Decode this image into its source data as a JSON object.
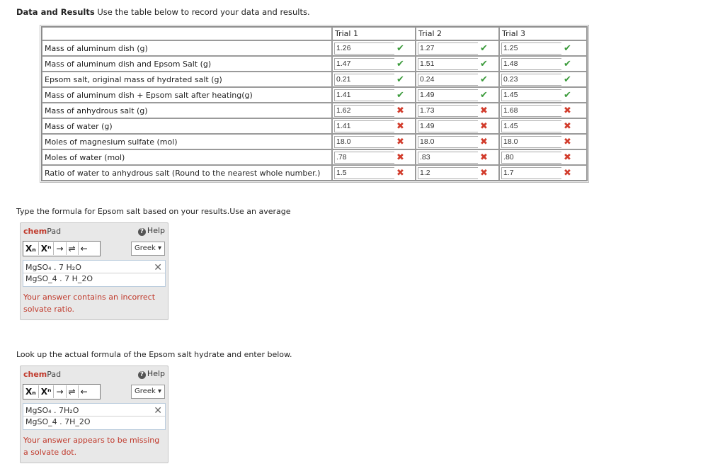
{
  "heading": {
    "bold": "Data and Results",
    "text": " Use the table below to record your data and results."
  },
  "table": {
    "trial_headers": [
      "Trial 1",
      "Trial 2",
      "Trial 3"
    ],
    "rows": [
      {
        "label": "Mass of aluminum dish (g)",
        "values": [
          "1.26",
          "1.27",
          "1.25"
        ],
        "status": [
          "correct",
          "correct",
          "correct"
        ]
      },
      {
        "label": "Mass of aluminum dish and Epsom Salt (g)",
        "values": [
          "1.47",
          "1.51",
          "1.48"
        ],
        "status": [
          "correct",
          "correct",
          "correct"
        ]
      },
      {
        "label": "Epsom salt, original mass of hydrated salt (g)",
        "values": [
          "0.21",
          "0.24",
          "0.23"
        ],
        "status": [
          "correct",
          "correct",
          "correct"
        ]
      },
      {
        "label": "Mass of aluminum dish + Epsom salt after heating(g)",
        "values": [
          "1.41",
          "1.49",
          "1.45"
        ],
        "status": [
          "correct",
          "correct",
          "correct"
        ]
      },
      {
        "label": "Mass of anhydrous salt (g)",
        "values": [
          "1.62",
          "1.73",
          "1.68"
        ],
        "status": [
          "incorrect",
          "incorrect",
          "incorrect"
        ]
      },
      {
        "label": "Mass of water (g)",
        "values": [
          "1.41",
          "1.49",
          "1.45"
        ],
        "status": [
          "incorrect",
          "incorrect",
          "incorrect"
        ]
      },
      {
        "label": "Moles of magnesium sulfate (mol)",
        "values": [
          "18.0",
          "18.0",
          "18.0"
        ],
        "status": [
          "incorrect",
          "incorrect",
          "incorrect"
        ]
      },
      {
        "label": "Moles of water (mol)",
        "values": [
          ".78",
          ".83",
          ".80"
        ],
        "status": [
          "incorrect",
          "incorrect",
          "incorrect"
        ]
      },
      {
        "label": "Ratio of water to anhydrous salt (Round to the nearest whole number.)",
        "values": [
          "1.5",
          "1.2",
          "1.7"
        ],
        "status": [
          "incorrect",
          "incorrect",
          "incorrect"
        ]
      }
    ]
  },
  "question1": {
    "text": "Type the formula for Epsom salt based on your results.Use an average"
  },
  "question2": {
    "text": "Look up the actual formula of the Epsom salt hydrate and enter below."
  },
  "chempad_common": {
    "title_chem": "chem",
    "title_pad": "Pad",
    "help_label": "Help",
    "greek_label": "Greek ▾",
    "tools": [
      "Xₙ",
      "Xⁿ",
      "→",
      "⇌",
      "←"
    ]
  },
  "answer1": {
    "rendered": "MgSO₄ . 7 H₂O",
    "raw": "MgSO_4 . 7 H_2O",
    "feedback": "Your answer contains an incorrect solvate ratio."
  },
  "answer2": {
    "rendered": "MgSO₄ . 7H₂O",
    "raw": "MgSO_4 . 7H_2O",
    "feedback": "Your answer appears to be missing a solvate dot."
  },
  "icons": {
    "correct": "check-icon",
    "incorrect": "cross-icon",
    "delete": "delete-icon",
    "help": "help-icon"
  },
  "colors": {
    "correct": "#3a9a3a",
    "incorrect": "#d23c2c",
    "chem_brand": "#c0392b"
  }
}
